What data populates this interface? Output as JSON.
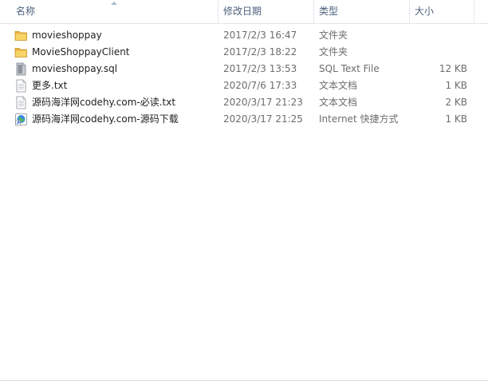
{
  "columns": {
    "name": "名称",
    "modified": "修改日期",
    "type": "类型",
    "size": "大小"
  },
  "files": [
    {
      "name": "movieshoppay",
      "modified": "2017/2/3 16:47",
      "type": "文件夹",
      "size": "",
      "icon": "folder-icon"
    },
    {
      "name": "MovieShoppayClient",
      "modified": "2017/2/3 18:22",
      "type": "文件夹",
      "size": "",
      "icon": "folder-icon"
    },
    {
      "name": "movieshoppay.sql",
      "modified": "2017/2/3 13:53",
      "type": "SQL Text File",
      "size": "12 KB",
      "icon": "sql-file-icon"
    },
    {
      "name": "更多.txt",
      "modified": "2020/7/6 17:33",
      "type": "文本文档",
      "size": "1 KB",
      "icon": "text-file-icon"
    },
    {
      "name": "源码海洋网codehy.com-必读.txt",
      "modified": "2020/3/17 21:23",
      "type": "文本文档",
      "size": "2 KB",
      "icon": "text-file-icon"
    },
    {
      "name": "源码海洋网codehy.com-源码下载",
      "modified": "2020/3/17 21:25",
      "type": "Internet 快捷方式",
      "size": "1 KB",
      "icon": "internet-shortcut-icon"
    }
  ]
}
